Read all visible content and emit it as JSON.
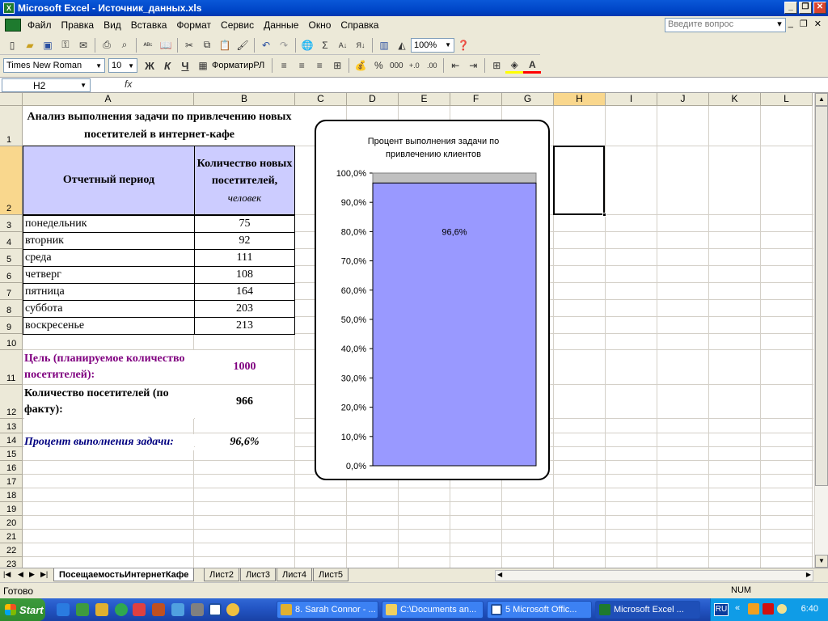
{
  "window": {
    "title": "Microsoft Excel - Источник_данных.xls",
    "app_icon": "X"
  },
  "menu": {
    "items": [
      "Файл",
      "Правка",
      "Вид",
      "Вставка",
      "Формат",
      "Сервис",
      "Данные",
      "Окно",
      "Справка"
    ],
    "help_placeholder": "Введите вопрос"
  },
  "toolbar": {
    "zoom": "100%",
    "font": "Times New Roman",
    "size": "10",
    "formatir": "ФорматирРЛ",
    "bold": "Ж",
    "italic": "К",
    "underline": "Ч",
    "percent": "%",
    "thousands": "000",
    "sigma": "Σ"
  },
  "formula_bar": {
    "name_box": "H2",
    "fx": "fx",
    "content": ""
  },
  "columns": [
    "A",
    "B",
    "C",
    "D",
    "E",
    "F",
    "G",
    "H",
    "I",
    "J",
    "K",
    "L"
  ],
  "selected_column": "H",
  "rows": [
    "1",
    "2",
    "3",
    "4",
    "5",
    "6",
    "7",
    "8",
    "9",
    "10",
    "11",
    "12",
    "13",
    "14",
    "15",
    "16",
    "17",
    "18",
    "19",
    "20",
    "21",
    "22",
    "23"
  ],
  "sheet": {
    "title": "Анализ выполнения задачи по привлечению новых посетителей в интернет-кафе",
    "header_period": "Отчетный период",
    "header_count": "Количество новых посетителей,",
    "header_unit": "человек",
    "days": [
      {
        "day": "понедельник",
        "count": "75"
      },
      {
        "day": "вторник",
        "count": "92"
      },
      {
        "day": "среда",
        "count": "111"
      },
      {
        "day": "четверг",
        "count": "108"
      },
      {
        "day": "пятница",
        "count": "164"
      },
      {
        "day": "суббота",
        "count": "203"
      },
      {
        "day": "воскресенье",
        "count": "213"
      }
    ],
    "goal_label": "Цель (планируемое количество посетителей):",
    "goal_value": "1000",
    "actual_label": "Количество посетителей (по факту):",
    "actual_value": "966",
    "percent_label": "Процент выполнения задачи:",
    "percent_value": "96,6%"
  },
  "chart_data": {
    "type": "bar",
    "title": "Процент выполнения задачи по привлечению клиентов",
    "categories": [
      ""
    ],
    "values": [
      96.6
    ],
    "data_label": "96,6%",
    "ylim": [
      0,
      100
    ],
    "yticks": [
      "0,0%",
      "10,0%",
      "20,0%",
      "30,0%",
      "40,0%",
      "50,0%",
      "60,0%",
      "70,0%",
      "80,0%",
      "90,0%",
      "100,0%"
    ],
    "bar_color": "#9999FF",
    "remainder_color": "#C0C0C0",
    "grid": false,
    "legend": "none"
  },
  "tabs": [
    "ПосещаемостьИнтернетКафе",
    "Лист2",
    "Лист3",
    "Лист4",
    "Лист5"
  ],
  "status": {
    "ready": "Готово",
    "num": "NUM"
  },
  "taskbar": {
    "start": "Start",
    "tasks": [
      "8. Sarah Connor - ...",
      "C:\\Documents an...",
      "5 Microsoft Offic...",
      "Microsoft Excel ..."
    ],
    "lang": "RU",
    "clock": "6:40"
  }
}
